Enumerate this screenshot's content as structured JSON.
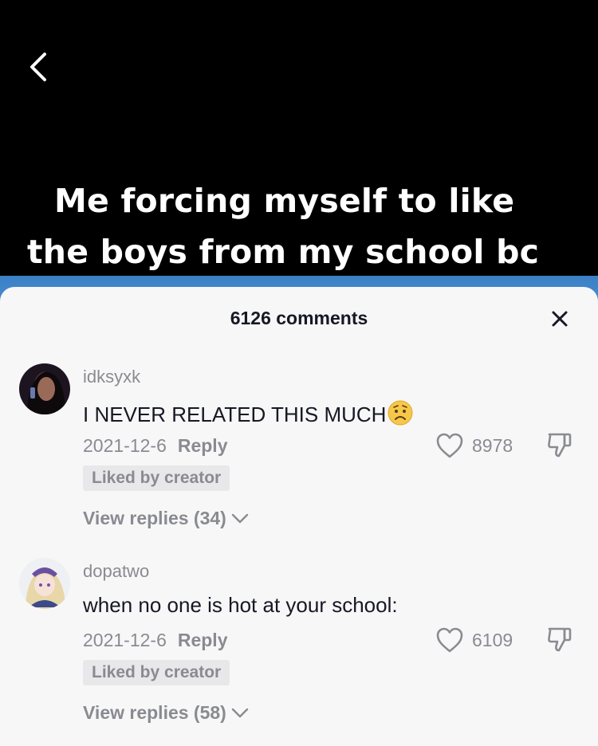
{
  "video": {
    "caption_line1": "Me forcing myself to like",
    "caption_line2": "the boys from my school bc"
  },
  "sheet": {
    "title": "6126 comments"
  },
  "comments": [
    {
      "username": "idksyxk",
      "text": "I NEVER RELATED THIS MUCH",
      "date": "2021-12-6",
      "reply_label": "Reply",
      "likes": "8978",
      "badge": "Liked by creator",
      "view_replies": "View replies (34)"
    },
    {
      "username": "dopatwo",
      "text": "when no one is hot at your school:",
      "date": "2021-12-6",
      "reply_label": "Reply",
      "likes": "6109",
      "badge": "Liked by creator",
      "view_replies": "View replies (58)"
    }
  ],
  "colors": {
    "sheet_bg": "#f7f7f8",
    "text_primary": "#161823",
    "text_secondary": "#8a8b91",
    "badge_bg": "#e8e8ea"
  }
}
